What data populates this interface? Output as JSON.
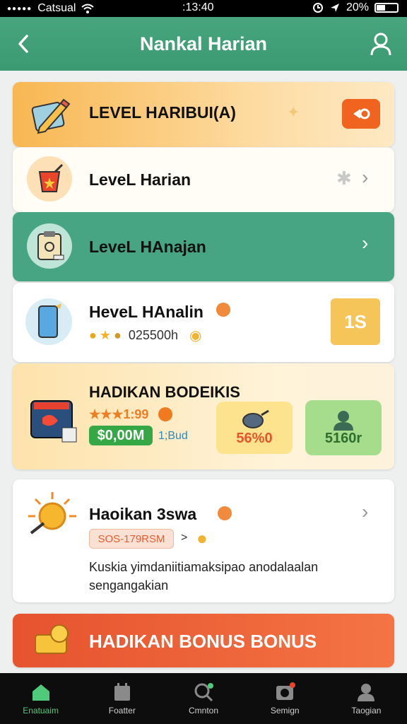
{
  "status_bar": {
    "carrier": "Catsual",
    "time": ":13:40",
    "battery": "20%"
  },
  "header": {
    "title": "Nankal Harian"
  },
  "cards": [
    {
      "title": "LEVEL HARIBUI(A)"
    },
    {
      "title": "LeveL Harian"
    },
    {
      "title": "LeveL HAnajan"
    },
    {
      "title": "HeveL HAnalin",
      "meta": "025500h",
      "badge": "1S"
    },
    {
      "title": "HADIKAN BODEIKIS",
      "rating": "★★★1:99",
      "amount": "$0,00M",
      "amount_suffix": "1;Bud",
      "reward1": "56%0",
      "reward2": "5160r"
    },
    {
      "title": "Haoikan 3swa",
      "code": "SOS-179RSM",
      "desc_line1": "Kuskia yimdaniitiamaksipao anodalaalan",
      "desc_line2": "sengangakian"
    },
    {
      "title": "HADIKAN BONUS BONUS"
    }
  ],
  "nav": [
    {
      "label": "Enatuaim",
      "icon": "home-icon"
    },
    {
      "label": "Foatter",
      "icon": "calendar-icon"
    },
    {
      "label": "Cmnton",
      "icon": "search-icon"
    },
    {
      "label": "Semign",
      "icon": "camera-icon"
    },
    {
      "label": "Taogian",
      "icon": "person-icon"
    }
  ],
  "colors": {
    "green": "#3b9a72",
    "orange": "#f47444",
    "gold": "#f6b94b"
  }
}
